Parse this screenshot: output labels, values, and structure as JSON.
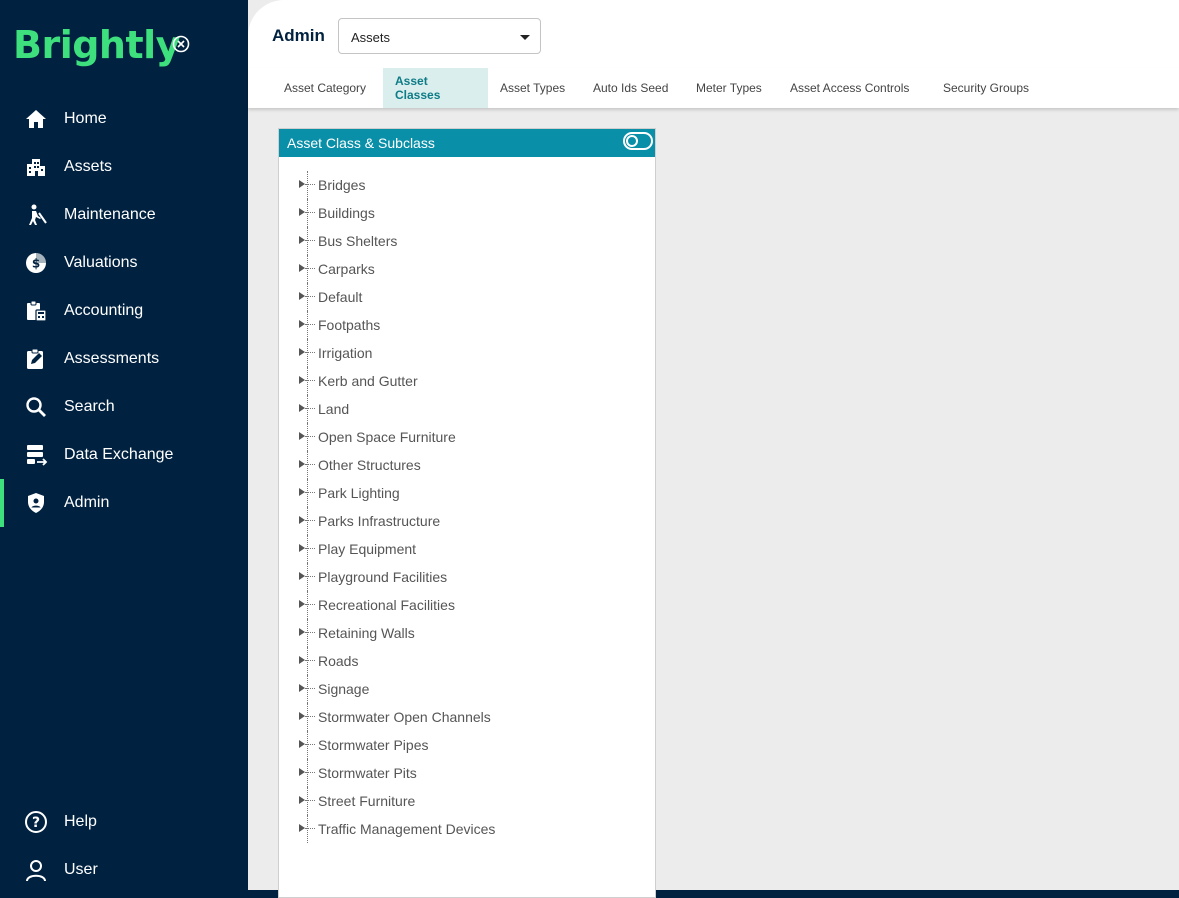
{
  "brand": {
    "name": "Brightly",
    "accent": "#3ee07e",
    "sidebar_bg": "#002240"
  },
  "sidebar": {
    "items": [
      {
        "label": "Home",
        "icon": "home-icon"
      },
      {
        "label": "Assets",
        "icon": "assets-icon"
      },
      {
        "label": "Maintenance",
        "icon": "maintenance-icon"
      },
      {
        "label": "Valuations",
        "icon": "valuations-icon"
      },
      {
        "label": "Accounting",
        "icon": "accounting-icon"
      },
      {
        "label": "Assessments",
        "icon": "assessments-icon"
      },
      {
        "label": "Search",
        "icon": "search-icon"
      },
      {
        "label": "Data Exchange",
        "icon": "data-exchange-icon"
      },
      {
        "label": "Admin",
        "icon": "admin-shield-icon",
        "active": true
      }
    ],
    "bottom_items": [
      {
        "label": "Help",
        "icon": "help-icon"
      },
      {
        "label": "User",
        "icon": "user-icon"
      }
    ]
  },
  "header": {
    "title": "Admin",
    "module_select": {
      "value": "Assets"
    }
  },
  "tabs": [
    {
      "label": "Asset Category"
    },
    {
      "label": "Asset Classes",
      "active": true
    },
    {
      "label": "Asset Types"
    },
    {
      "label": "Auto Ids Seed"
    },
    {
      "label": "Meter Types"
    },
    {
      "label": "Asset Access Controls"
    },
    {
      "label": "Security Groups"
    }
  ],
  "panel": {
    "title": "Asset Class & Subclass",
    "header_color": "#0a8fa8",
    "tree_items": [
      "Bridges",
      "Buildings",
      "Bus Shelters",
      "Carparks",
      "Default",
      "Footpaths",
      "Irrigation",
      "Kerb and Gutter",
      "Land",
      "Open Space Furniture",
      "Other Structures",
      "Park Lighting",
      "Parks Infrastructure",
      "Play Equipment",
      "Playground Facilities",
      "Recreational Facilities",
      "Retaining Walls",
      "Roads",
      "Signage",
      "Stormwater Open Channels",
      "Stormwater Pipes",
      "Stormwater Pits",
      "Street Furniture",
      "Traffic Management Devices"
    ]
  }
}
